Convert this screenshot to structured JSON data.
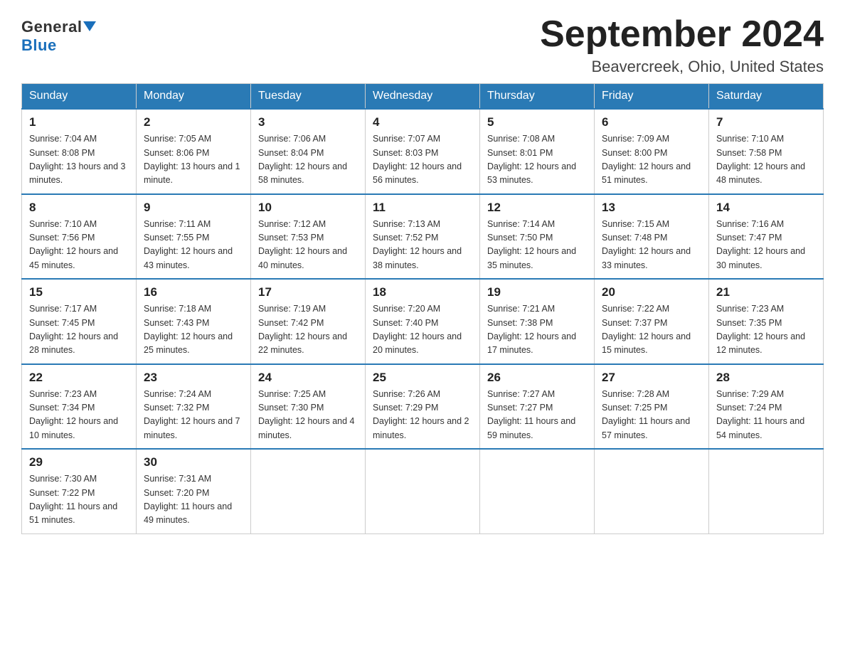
{
  "header": {
    "logo_general": "General",
    "logo_blue": "Blue",
    "month_year": "September 2024",
    "location": "Beavercreek, Ohio, United States"
  },
  "days_of_week": [
    "Sunday",
    "Monday",
    "Tuesday",
    "Wednesday",
    "Thursday",
    "Friday",
    "Saturday"
  ],
  "weeks": [
    [
      {
        "day": "1",
        "sunrise": "7:04 AM",
        "sunset": "8:08 PM",
        "daylight": "13 hours and 3 minutes."
      },
      {
        "day": "2",
        "sunrise": "7:05 AM",
        "sunset": "8:06 PM",
        "daylight": "13 hours and 1 minute."
      },
      {
        "day": "3",
        "sunrise": "7:06 AM",
        "sunset": "8:04 PM",
        "daylight": "12 hours and 58 minutes."
      },
      {
        "day": "4",
        "sunrise": "7:07 AM",
        "sunset": "8:03 PM",
        "daylight": "12 hours and 56 minutes."
      },
      {
        "day": "5",
        "sunrise": "7:08 AM",
        "sunset": "8:01 PM",
        "daylight": "12 hours and 53 minutes."
      },
      {
        "day": "6",
        "sunrise": "7:09 AM",
        "sunset": "8:00 PM",
        "daylight": "12 hours and 51 minutes."
      },
      {
        "day": "7",
        "sunrise": "7:10 AM",
        "sunset": "7:58 PM",
        "daylight": "12 hours and 48 minutes."
      }
    ],
    [
      {
        "day": "8",
        "sunrise": "7:10 AM",
        "sunset": "7:56 PM",
        "daylight": "12 hours and 45 minutes."
      },
      {
        "day": "9",
        "sunrise": "7:11 AM",
        "sunset": "7:55 PM",
        "daylight": "12 hours and 43 minutes."
      },
      {
        "day": "10",
        "sunrise": "7:12 AM",
        "sunset": "7:53 PM",
        "daylight": "12 hours and 40 minutes."
      },
      {
        "day": "11",
        "sunrise": "7:13 AM",
        "sunset": "7:52 PM",
        "daylight": "12 hours and 38 minutes."
      },
      {
        "day": "12",
        "sunrise": "7:14 AM",
        "sunset": "7:50 PM",
        "daylight": "12 hours and 35 minutes."
      },
      {
        "day": "13",
        "sunrise": "7:15 AM",
        "sunset": "7:48 PM",
        "daylight": "12 hours and 33 minutes."
      },
      {
        "day": "14",
        "sunrise": "7:16 AM",
        "sunset": "7:47 PM",
        "daylight": "12 hours and 30 minutes."
      }
    ],
    [
      {
        "day": "15",
        "sunrise": "7:17 AM",
        "sunset": "7:45 PM",
        "daylight": "12 hours and 28 minutes."
      },
      {
        "day": "16",
        "sunrise": "7:18 AM",
        "sunset": "7:43 PM",
        "daylight": "12 hours and 25 minutes."
      },
      {
        "day": "17",
        "sunrise": "7:19 AM",
        "sunset": "7:42 PM",
        "daylight": "12 hours and 22 minutes."
      },
      {
        "day": "18",
        "sunrise": "7:20 AM",
        "sunset": "7:40 PM",
        "daylight": "12 hours and 20 minutes."
      },
      {
        "day": "19",
        "sunrise": "7:21 AM",
        "sunset": "7:38 PM",
        "daylight": "12 hours and 17 minutes."
      },
      {
        "day": "20",
        "sunrise": "7:22 AM",
        "sunset": "7:37 PM",
        "daylight": "12 hours and 15 minutes."
      },
      {
        "day": "21",
        "sunrise": "7:23 AM",
        "sunset": "7:35 PM",
        "daylight": "12 hours and 12 minutes."
      }
    ],
    [
      {
        "day": "22",
        "sunrise": "7:23 AM",
        "sunset": "7:34 PM",
        "daylight": "12 hours and 10 minutes."
      },
      {
        "day": "23",
        "sunrise": "7:24 AM",
        "sunset": "7:32 PM",
        "daylight": "12 hours and 7 minutes."
      },
      {
        "day": "24",
        "sunrise": "7:25 AM",
        "sunset": "7:30 PM",
        "daylight": "12 hours and 4 minutes."
      },
      {
        "day": "25",
        "sunrise": "7:26 AM",
        "sunset": "7:29 PM",
        "daylight": "12 hours and 2 minutes."
      },
      {
        "day": "26",
        "sunrise": "7:27 AM",
        "sunset": "7:27 PM",
        "daylight": "11 hours and 59 minutes."
      },
      {
        "day": "27",
        "sunrise": "7:28 AM",
        "sunset": "7:25 PM",
        "daylight": "11 hours and 57 minutes."
      },
      {
        "day": "28",
        "sunrise": "7:29 AM",
        "sunset": "7:24 PM",
        "daylight": "11 hours and 54 minutes."
      }
    ],
    [
      {
        "day": "29",
        "sunrise": "7:30 AM",
        "sunset": "7:22 PM",
        "daylight": "11 hours and 51 minutes."
      },
      {
        "day": "30",
        "sunrise": "7:31 AM",
        "sunset": "7:20 PM",
        "daylight": "11 hours and 49 minutes."
      },
      null,
      null,
      null,
      null,
      null
    ]
  ]
}
